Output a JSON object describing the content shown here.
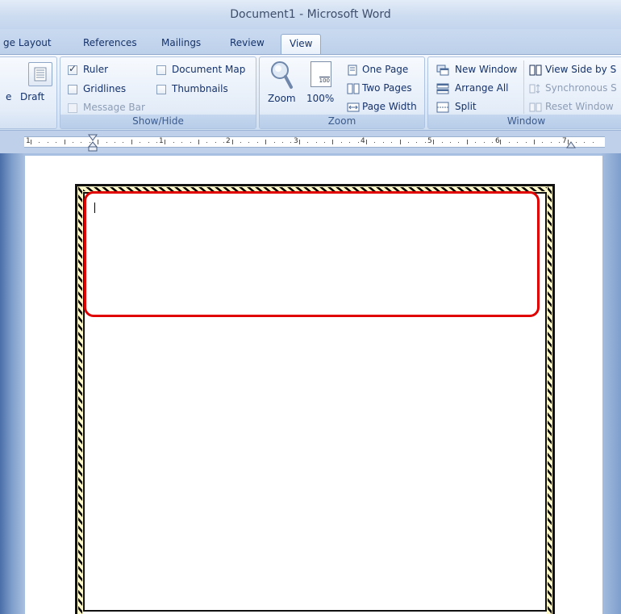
{
  "window": {
    "title": "Document1 - Microsoft Word"
  },
  "tabs": [
    {
      "label": "ge Layout"
    },
    {
      "label": "References"
    },
    {
      "label": "Mailings"
    },
    {
      "label": "Review"
    },
    {
      "label": "View"
    }
  ],
  "ribbon": {
    "views": {
      "draft_label": "Draft",
      "partial_label": "e"
    },
    "show_hide": {
      "label": "Show/Hide",
      "ruler": {
        "label": "Ruler",
        "checked": true
      },
      "gridlines": {
        "label": "Gridlines",
        "checked": false
      },
      "message_bar": {
        "label": "Message Bar",
        "checked": false
      },
      "document_map": {
        "label": "Document Map",
        "checked": false
      },
      "thumbnails": {
        "label": "Thumbnails",
        "checked": false
      }
    },
    "zoom": {
      "label": "Zoom",
      "zoom_button": "Zoom",
      "hundred_button": "100%",
      "hundred_icon_text": "100",
      "one_page": "One Page",
      "two_pages": "Two Pages",
      "page_width": "Page Width"
    },
    "window": {
      "label": "Window",
      "new_window": "New Window",
      "arrange_all": "Arrange All",
      "split": "Split",
      "view_side_by_side": "View Side by S",
      "synchronous": "Synchronous S",
      "reset_window": "Reset Window"
    }
  },
  "ruler": {
    "numbers": [
      "1",
      "1",
      "2",
      "3",
      "4",
      "5",
      "6",
      "7"
    ]
  },
  "colors": {
    "accent": "#e00000",
    "ribbon_text": "#15326a"
  }
}
